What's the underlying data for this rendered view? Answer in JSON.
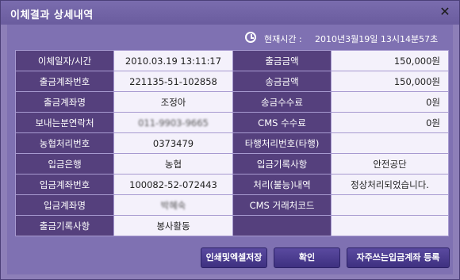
{
  "dialog": {
    "title": "이체결과 상세내역",
    "close_glyph": "✕",
    "current_time_label": "현재시간 :",
    "current_time_value": "2010년3월19일 13시14분57초"
  },
  "rows": [
    {
      "l1": "이체일자/시간",
      "v1": "2010.03.19 13:11:17",
      "l2": "출금금액",
      "v2": "150,000원"
    },
    {
      "l1": "출금계좌번호",
      "v1": "221135-51-102858",
      "l2": "송금금액",
      "v2": "150,000원"
    },
    {
      "l1": "출금계좌명",
      "v1": "조정아",
      "l2": "송금수수료",
      "v2": "0원"
    },
    {
      "l1": "보내는분연락처",
      "v1": "011-9903-9665",
      "l2": "CMS 수수료",
      "v2": "0원"
    },
    {
      "l1": "농협처리번호",
      "v1": "0373479",
      "l2": "타행처리번호(타행)",
      "v2": ""
    },
    {
      "l1": "입금은행",
      "v1": "농협",
      "l2": "입금기록사항",
      "v2": "안전공단"
    },
    {
      "l1": "입금계좌번호",
      "v1": "100082-52-072443",
      "l2": "처리(불능)내역",
      "v2": "정상처리되었습니다."
    },
    {
      "l1": "입금계좌명",
      "v1": "박혜숙",
      "l2": "CMS 거래처코드",
      "v2": ""
    },
    {
      "l1": "출금기록사항",
      "v1": "봉사활동",
      "l2": "",
      "v2": ""
    }
  ],
  "buttons": {
    "print_excel": "인쇄및엑셀저장",
    "confirm": "확인",
    "register_frequent": "자주쓰는입금계좌 등록"
  }
}
